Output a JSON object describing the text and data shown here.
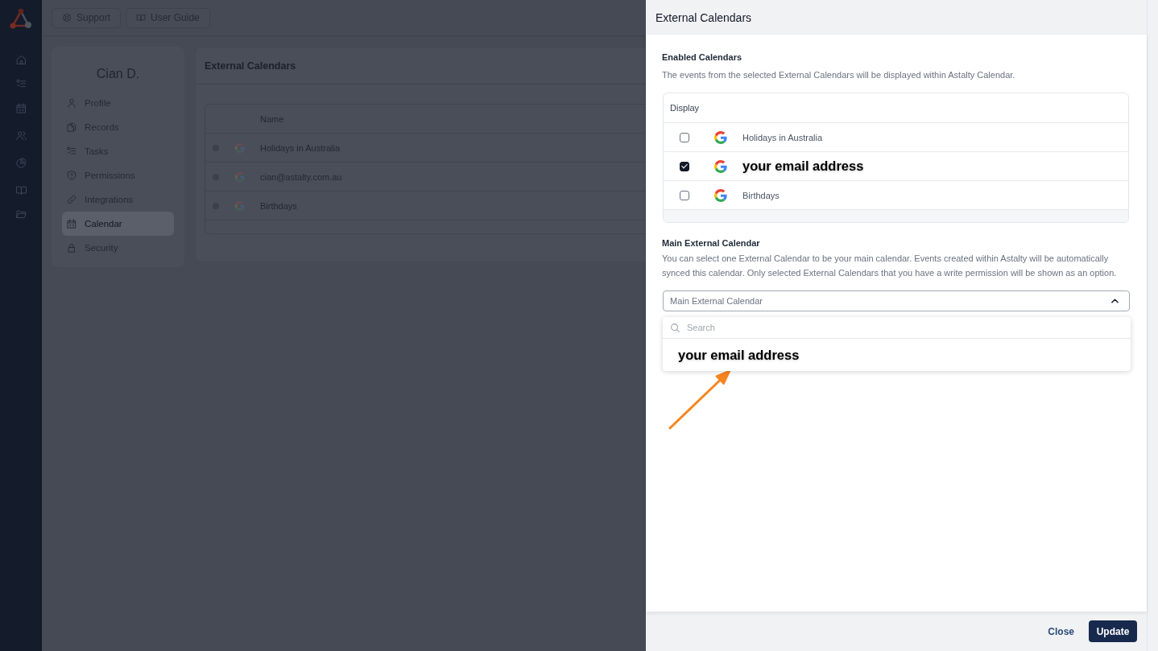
{
  "toolbar": {
    "buttons": [
      "Support",
      "User Guide"
    ]
  },
  "profile_card": {
    "name": "Cian D.",
    "items": [
      {
        "label": "Profile",
        "selected": false
      },
      {
        "label": "Records",
        "selected": false
      },
      {
        "label": "Tasks",
        "selected": false
      },
      {
        "label": "Permissions",
        "selected": false
      },
      {
        "label": "Integrations",
        "selected": false
      },
      {
        "label": "Calendar",
        "selected": true
      },
      {
        "label": "Security",
        "selected": false
      }
    ]
  },
  "calendars_card": {
    "title": "External Calendars",
    "table": {
      "columns": [
        "Name"
      ],
      "rows": [
        "Holidays in Australia",
        "cian@astalty.com.au",
        "Birthdays"
      ]
    }
  },
  "drawer": {
    "title": "External Calendars",
    "enabled": {
      "heading": "Enabled Calendars",
      "description": "The events from the selected External Calendars will be displayed within Astalty Calendar.",
      "column": "Display",
      "rows": [
        {
          "name": "Holidays in Australia",
          "checked": false,
          "emphasized": false
        },
        {
          "name": "your email address",
          "checked": true,
          "emphasized": true
        },
        {
          "name": "Birthdays",
          "checked": false,
          "emphasized": false
        }
      ]
    },
    "main": {
      "heading": "Main External Calendar",
      "description": "You can select one External Calendar to be your main calendar. Events created within Astalty will be automatically synced this calendar. Only selected External Calendars that you have a write permission will be shown as an option.",
      "select": {
        "placeholder": "Main External Calendar",
        "expanded": true
      },
      "dropdown": {
        "search": {
          "placeholder": "Search"
        },
        "options": [
          {
            "label": "your email address",
            "selected": false,
            "emphasized": true
          }
        ]
      }
    },
    "buttons": [
      {
        "label": "Close",
        "kind": "link"
      },
      {
        "label": "Update",
        "kind": "primary"
      }
    ]
  },
  "annotations": [
    {
      "kind": "arrow"
    }
  ]
}
